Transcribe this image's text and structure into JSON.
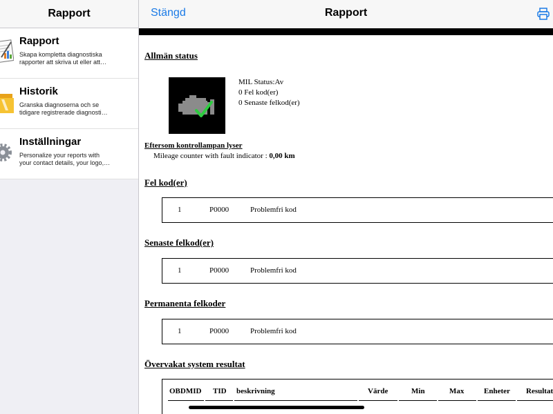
{
  "sidebar": {
    "title": "Rapport",
    "items": [
      {
        "title": "Rapport",
        "desc1": "Skapa kompletta diagnostiska",
        "desc2": "rapporter att skriva ut eller att…",
        "icon": "report-document-icon"
      },
      {
        "title": "Historik",
        "desc1": "Granska diagnoserna och se",
        "desc2": "tidigare registrerade diagnosti…",
        "icon": "history-folder-icon"
      },
      {
        "title": "Inställningar",
        "desc1": "Personalize your reports with",
        "desc2": "your contact details, your logo,…",
        "icon": "settings-gear-icon"
      }
    ]
  },
  "header": {
    "close_label": "Stängd",
    "title": "Rapport",
    "print_icon": "printer-icon",
    "accent_color": "#1a7ae6"
  },
  "report": {
    "general_heading": "Allmän status",
    "mil_status": "MIL Status:Av",
    "fault_count": "0 Fel kod(er)",
    "recent_count": "0 Senaste felkod(er)",
    "engine_icon": "check-engine-ok-icon",
    "warning_title": "Eftersom kontrollampan lyser",
    "mileage_label": "Mileage counter with fault indicator : ",
    "mileage_value": "0,00 km",
    "sections": [
      {
        "heading": "Fel kod(er)",
        "num": "1",
        "code": "P0000",
        "desc": "Problemfri kod"
      },
      {
        "heading": "Senaste felkod(er)",
        "num": "1",
        "code": "P0000",
        "desc": "Problemfri kod"
      },
      {
        "heading": "Permanenta felkoder",
        "num": "1",
        "code": "P0000",
        "desc": "Problemfri kod"
      }
    ],
    "monitor_heading": "Övervakat system resultat",
    "monitor_columns": [
      "OBDMID",
      "TID",
      "beskrivning",
      "Värde",
      "Min",
      "Max",
      "Enheter",
      "Resultat"
    ]
  }
}
